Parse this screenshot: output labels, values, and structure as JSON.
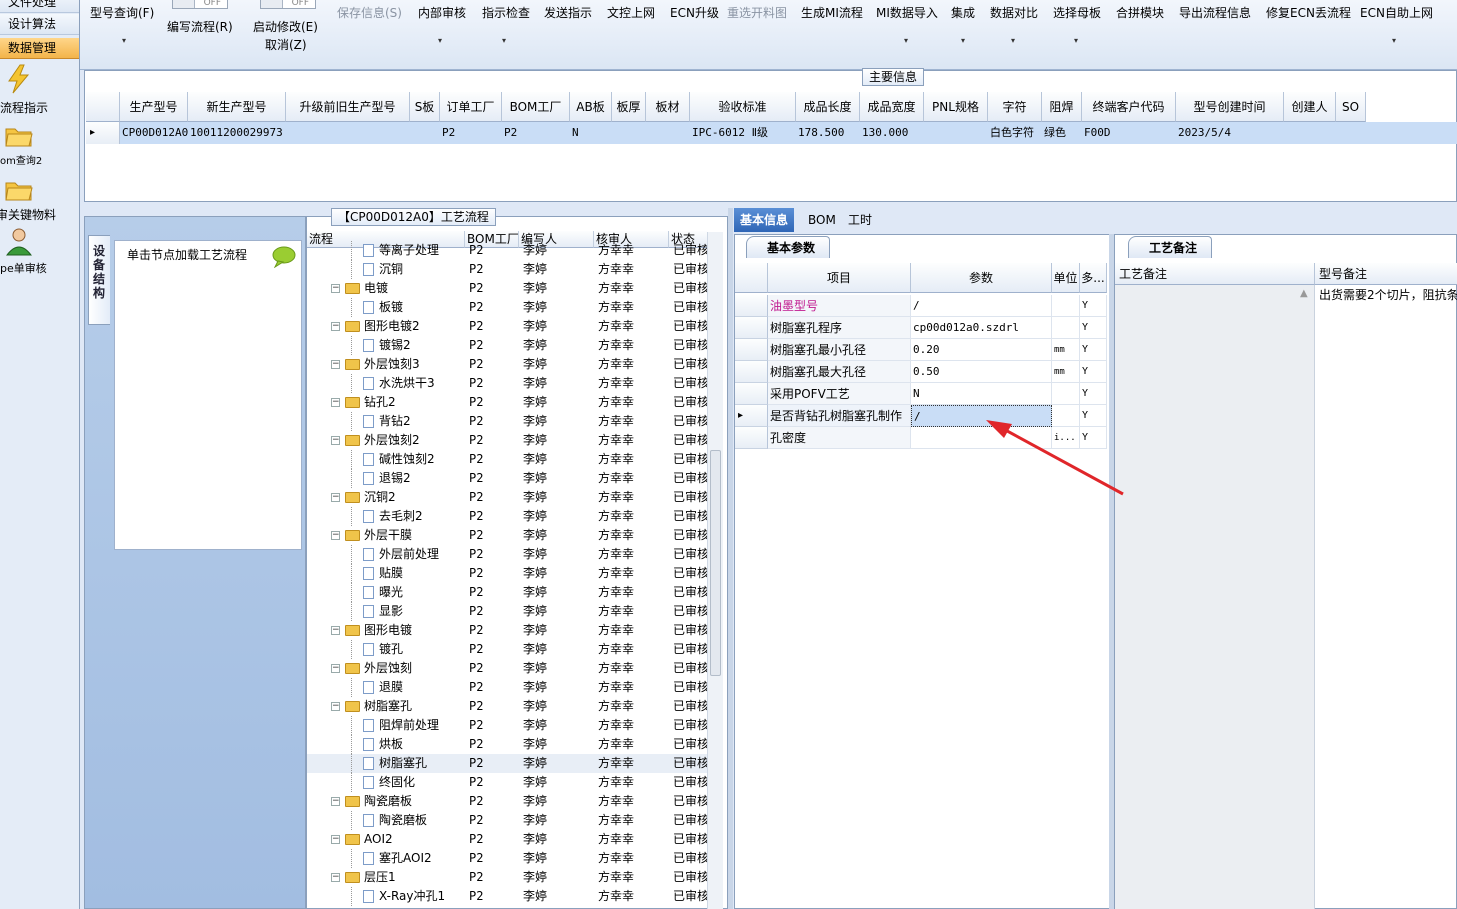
{
  "left_nav": {
    "tabs": [
      "文件处理",
      "设计算法",
      "数据管理"
    ],
    "active_tab": "数据管理",
    "items": [
      {
        "label": "流程指示",
        "icon": "lightning-icon"
      },
      {
        "label": "om查询2",
        "icon": "folder-icon"
      },
      {
        "label": "审关键物料",
        "icon": "folder-icon"
      },
      {
        "label": "pe单审核",
        "icon": "user-icon"
      }
    ]
  },
  "toolbar": {
    "xinghao_query": "型号查询(F)",
    "bianxie": "编写流程(R)",
    "qidong": "启动修改(E)",
    "quxiao": "取消(Z)",
    "toggle_off": "OFF",
    "save_info": "保存信息(S)",
    "internal_review": "内部审核",
    "guide_check": "指示检查",
    "send_guide": "发送指示",
    "doc_online": "文控上网",
    "ecn_upgrade": "ECN升级",
    "reopen_drawing": "重选开料图",
    "gen_mi": "生成MI流程",
    "mi_import": "MI数据导入",
    "integrate": "集成",
    "data_compare": "数据对比",
    "select_mother": "选择母板",
    "merge_module": "合拼模块",
    "export_flow": "导出流程信息",
    "fix_ecn": "修复ECN丢流程",
    "ecn_auto": "ECN自助上网",
    "dropdown_glyph": "▾"
  },
  "main_info": {
    "title": "主要信息",
    "headers": [
      "生产型号",
      "新生产型号",
      "升级前旧生产型号",
      "S板",
      "订单工厂",
      "BOM工厂",
      "AB板",
      "板厚",
      "板材",
      "验收标准",
      "成品长度",
      "成品宽度",
      "PNL规格",
      "字符",
      "阻焊",
      "终端客户代码",
      "型号创建时间",
      "创建人",
      "SO"
    ],
    "row": [
      "CP00D012A0",
      "10011200029973",
      "",
      "",
      "P2",
      "P2",
      "N",
      "",
      "",
      "IPC-6012 Ⅱ级",
      "178.500",
      "130.000",
      "",
      "白色字符",
      "绿色",
      "F00D",
      "2023/5/4",
      "",
      ""
    ]
  },
  "structure": {
    "tab_label": "设备结构",
    "hint": "单击节点加载工艺流程"
  },
  "flow": {
    "title": "【CP00D012A0】工艺流程",
    "headers": [
      "流程",
      "BOM工厂",
      "编写人",
      "核审人",
      "状态"
    ],
    "rows": [
      {
        "name": "等离子处理",
        "level": 2,
        "bom": "P2",
        "writer": "李婷",
        "reviewer": "方幸幸",
        "status": "已审核"
      },
      {
        "name": "沉铜",
        "level": 2,
        "bom": "P2",
        "writer": "李婷",
        "reviewer": "方幸幸",
        "status": "已审核"
      },
      {
        "name": "电镀",
        "level": 1,
        "bom": "P2",
        "writer": "李婷",
        "reviewer": "方幸幸",
        "status": "已审核"
      },
      {
        "name": "板镀",
        "level": 2,
        "bom": "P2",
        "writer": "李婷",
        "reviewer": "方幸幸",
        "status": "已审核"
      },
      {
        "name": "图形电镀2",
        "level": 1,
        "bom": "P2",
        "writer": "李婷",
        "reviewer": "方幸幸",
        "status": "已审核"
      },
      {
        "name": "镀锡2",
        "level": 2,
        "bom": "P2",
        "writer": "李婷",
        "reviewer": "方幸幸",
        "status": "已审核"
      },
      {
        "name": "外层蚀刻3",
        "level": 1,
        "bom": "P2",
        "writer": "李婷",
        "reviewer": "方幸幸",
        "status": "已审核"
      },
      {
        "name": "水洗烘干3",
        "level": 2,
        "bom": "P2",
        "writer": "李婷",
        "reviewer": "方幸幸",
        "status": "已审核"
      },
      {
        "name": "钻孔2",
        "level": 1,
        "bom": "P2",
        "writer": "李婷",
        "reviewer": "方幸幸",
        "status": "已审核"
      },
      {
        "name": "背钻2",
        "level": 2,
        "bom": "P2",
        "writer": "李婷",
        "reviewer": "方幸幸",
        "status": "已审核"
      },
      {
        "name": "外层蚀刻2",
        "level": 1,
        "bom": "P2",
        "writer": "李婷",
        "reviewer": "方幸幸",
        "status": "已审核"
      },
      {
        "name": "碱性蚀刻2",
        "level": 2,
        "bom": "P2",
        "writer": "李婷",
        "reviewer": "方幸幸",
        "status": "已审核"
      },
      {
        "name": "退锡2",
        "level": 2,
        "bom": "P2",
        "writer": "李婷",
        "reviewer": "方幸幸",
        "status": "已审核"
      },
      {
        "name": "沉铜2",
        "level": 1,
        "bom": "P2",
        "writer": "李婷",
        "reviewer": "方幸幸",
        "status": "已审核"
      },
      {
        "name": "去毛刺2",
        "level": 2,
        "bom": "P2",
        "writer": "李婷",
        "reviewer": "方幸幸",
        "status": "已审核"
      },
      {
        "name": "外层干膜",
        "level": 1,
        "bom": "P2",
        "writer": "李婷",
        "reviewer": "方幸幸",
        "status": "已审核"
      },
      {
        "name": "外层前处理",
        "level": 2,
        "bom": "P2",
        "writer": "李婷",
        "reviewer": "方幸幸",
        "status": "已审核"
      },
      {
        "name": "贴膜",
        "level": 2,
        "bom": "P2",
        "writer": "李婷",
        "reviewer": "方幸幸",
        "status": "已审核"
      },
      {
        "name": "曝光",
        "level": 2,
        "bom": "P2",
        "writer": "李婷",
        "reviewer": "方幸幸",
        "status": "已审核"
      },
      {
        "name": "显影",
        "level": 2,
        "bom": "P2",
        "writer": "李婷",
        "reviewer": "方幸幸",
        "status": "已审核"
      },
      {
        "name": "图形电镀",
        "level": 1,
        "bom": "P2",
        "writer": "李婷",
        "reviewer": "方幸幸",
        "status": "已审核"
      },
      {
        "name": "镀孔",
        "level": 2,
        "bom": "P2",
        "writer": "李婷",
        "reviewer": "方幸幸",
        "status": "已审核"
      },
      {
        "name": "外层蚀刻",
        "level": 1,
        "bom": "P2",
        "writer": "李婷",
        "reviewer": "方幸幸",
        "status": "已审核"
      },
      {
        "name": "退膜",
        "level": 2,
        "bom": "P2",
        "writer": "李婷",
        "reviewer": "方幸幸",
        "status": "已审核"
      },
      {
        "name": "树脂塞孔",
        "level": 1,
        "bom": "P2",
        "writer": "李婷",
        "reviewer": "方幸幸",
        "status": "已审核"
      },
      {
        "name": "阻焊前处理",
        "level": 2,
        "bom": "P2",
        "writer": "李婷",
        "reviewer": "方幸幸",
        "status": "已审核"
      },
      {
        "name": "烘板",
        "level": 2,
        "bom": "P2",
        "writer": "李婷",
        "reviewer": "方幸幸",
        "status": "已审核"
      },
      {
        "name": "树脂塞孔",
        "level": 2,
        "bom": "P2",
        "writer": "李婷",
        "reviewer": "方幸幸",
        "status": "已审核",
        "selected": true
      },
      {
        "name": "终固化",
        "level": 2,
        "bom": "P2",
        "writer": "李婷",
        "reviewer": "方幸幸",
        "status": "已审核"
      },
      {
        "name": "陶瓷磨板",
        "level": 1,
        "bom": "P2",
        "writer": "李婷",
        "reviewer": "方幸幸",
        "status": "已审核"
      },
      {
        "name": "陶瓷磨板",
        "level": 2,
        "bom": "P2",
        "writer": "李婷",
        "reviewer": "方幸幸",
        "status": "已审核"
      },
      {
        "name": "AOI2",
        "level": 1,
        "bom": "P2",
        "writer": "李婷",
        "reviewer": "方幸幸",
        "status": "已审核"
      },
      {
        "name": "塞孔AOI2",
        "level": 2,
        "bom": "P2",
        "writer": "李婷",
        "reviewer": "方幸幸",
        "status": "已审核"
      },
      {
        "name": "层压1",
        "level": 1,
        "bom": "P2",
        "writer": "李婷",
        "reviewer": "方幸幸",
        "status": "已审核"
      },
      {
        "name": "X-Ray冲孔1",
        "level": 2,
        "bom": "P2",
        "writer": "李婷",
        "reviewer": "方幸幸",
        "status": "已审核"
      }
    ]
  },
  "right": {
    "tabs": [
      "基本信息",
      "BOM",
      "工时"
    ],
    "active_tab": "基本信息",
    "params_title": "基本参数",
    "param_headers": [
      "项目",
      "参数",
      "单位",
      "多..."
    ],
    "params": [
      {
        "item": "油墨型号",
        "value": "/",
        "unit": "",
        "flag": "Y",
        "highlight": true
      },
      {
        "item": "树脂塞孔程序",
        "value": "cp00d012a0.szdrl",
        "unit": "",
        "flag": "Y"
      },
      {
        "item": "树脂塞孔最小孔径",
        "value": "0.20",
        "unit": "mm",
        "flag": "Y"
      },
      {
        "item": "树脂塞孔最大孔径",
        "value": "0.50",
        "unit": "mm",
        "flag": "Y"
      },
      {
        "item": "采用POFV工艺",
        "value": "N",
        "unit": "",
        "flag": "Y"
      },
      {
        "item": "是否背钻孔树脂塞孔制作",
        "value": "/",
        "unit": "",
        "flag": "Y",
        "selected": true
      },
      {
        "item": "孔密度",
        "value": "",
        "unit": "i...",
        "flag": "Y"
      }
    ],
    "notes_title": "工艺备注",
    "note_headers": [
      "工艺备注",
      "型号备注"
    ],
    "model_note": "出货需要2个切片，阻抗条"
  },
  "colors": {
    "selection": "#c9ddf6",
    "active_tab": "#2f66b6",
    "highlight_text": "#c0198f",
    "arrow": "#e0262a"
  }
}
